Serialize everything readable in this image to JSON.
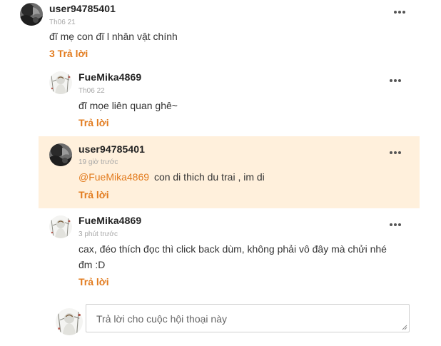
{
  "accent_color": "#e27b1e",
  "highlight_color": "#fff0dc",
  "top_comment": {
    "username": "user94785401",
    "time": "Th06 21",
    "text": "đĩ mẹ con đĩ l nhân vật chính",
    "replies_link": "3 Trả lời",
    "avatar_icon": "dark-ink-avatar-icon",
    "menu_icon": "more-dots-icon"
  },
  "replies": [
    {
      "username": "FueMika4869",
      "time": "Th06 22",
      "text": "đĩ mọe liên quan ghê~",
      "reply_label": "Trả lời",
      "avatar_icon": "sketch-figure-avatar-icon"
    },
    {
      "username": "user94785401",
      "time": "19 giờ trước",
      "mention": "@FueMika4869",
      "text": "con di thich du trai , im di",
      "reply_label": "Trả lời",
      "avatar_icon": "dark-ink-avatar-icon"
    },
    {
      "username": "FueMika4869",
      "time": "3 phút trước",
      "text_line1": "cax, đéo thích đọc thì click back dùm, không phải vô đây mà chửi nhé",
      "text_line2": "đm :D",
      "reply_label": "Trả lời",
      "avatar_icon": "sketch-figure-avatar-icon"
    }
  ],
  "reply_box": {
    "placeholder": "Trả lời cho cuộc hội thoại này",
    "value": "",
    "avatar_icon": "sketch-figure-avatar-icon"
  }
}
